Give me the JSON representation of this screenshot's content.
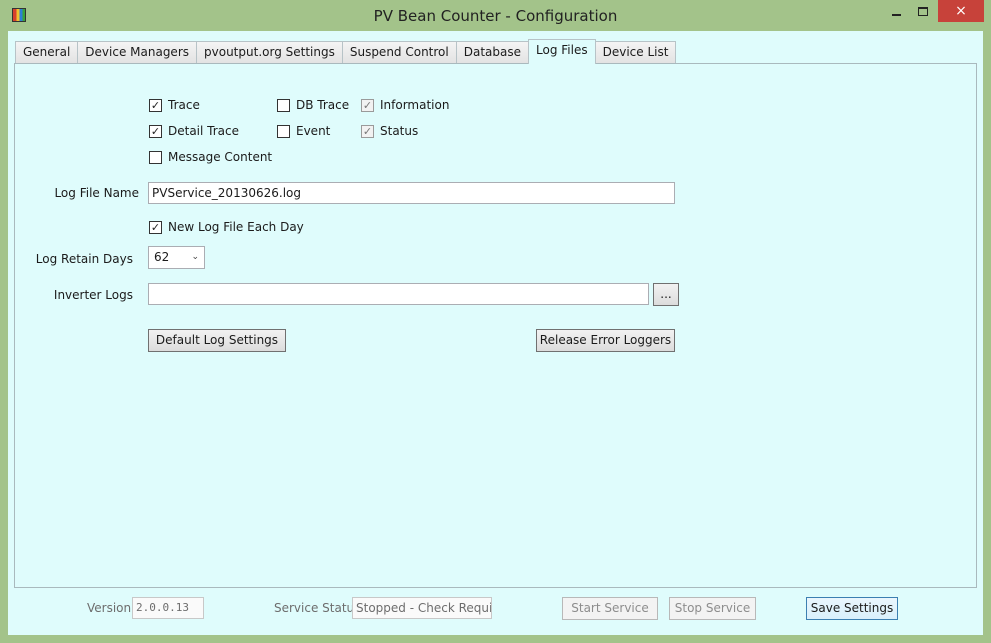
{
  "window": {
    "title": "PV Bean Counter - Configuration"
  },
  "tabs": [
    {
      "label": "General",
      "active": false
    },
    {
      "label": "Device Managers",
      "active": false
    },
    {
      "label": "pvoutput.org Settings",
      "active": false
    },
    {
      "label": "Suspend Control",
      "active": false
    },
    {
      "label": "Database",
      "active": false
    },
    {
      "label": "Log Files",
      "active": true
    },
    {
      "label": "Device List",
      "active": false
    }
  ],
  "log_options": {
    "trace": {
      "label": "Trace",
      "checked": true
    },
    "detail_trace": {
      "label": "Detail Trace",
      "checked": true
    },
    "message_content": {
      "label": "Message Content",
      "checked": false
    },
    "db_trace": {
      "label": "DB Trace",
      "checked": false
    },
    "event": {
      "label": "Event",
      "checked": false
    },
    "information": {
      "label": "Information",
      "checked": true
    },
    "status": {
      "label": "Status",
      "checked": true
    }
  },
  "log_file_name": {
    "label": "Log File Name",
    "value": "PVService_20130626.log"
  },
  "new_log_each_day": {
    "label": "New Log File Each Day",
    "checked": true
  },
  "log_retain_days": {
    "label": "Log Retain Days",
    "value": "62"
  },
  "inverter_logs": {
    "label": "Inverter Logs",
    "value": "",
    "browse_label": "..."
  },
  "buttons": {
    "default_log_settings": "Default Log Settings",
    "release_error_loggers": "Release Error Loggers"
  },
  "footer": {
    "version_label": "Version",
    "version_value": "2.0.0.13",
    "service_status_label": "Service Status",
    "service_status_value": "Stopped - Check Required",
    "start_service": "Start Service",
    "stop_service": "Stop Service",
    "save_settings": "Save Settings"
  },
  "colors": {
    "window_frame": "#a3c38a",
    "client_background": "#dffcfc",
    "close_button": "#c7423a"
  },
  "icons": {
    "check": "✓",
    "dropdown": "chevron-down-icon",
    "close": "×"
  }
}
